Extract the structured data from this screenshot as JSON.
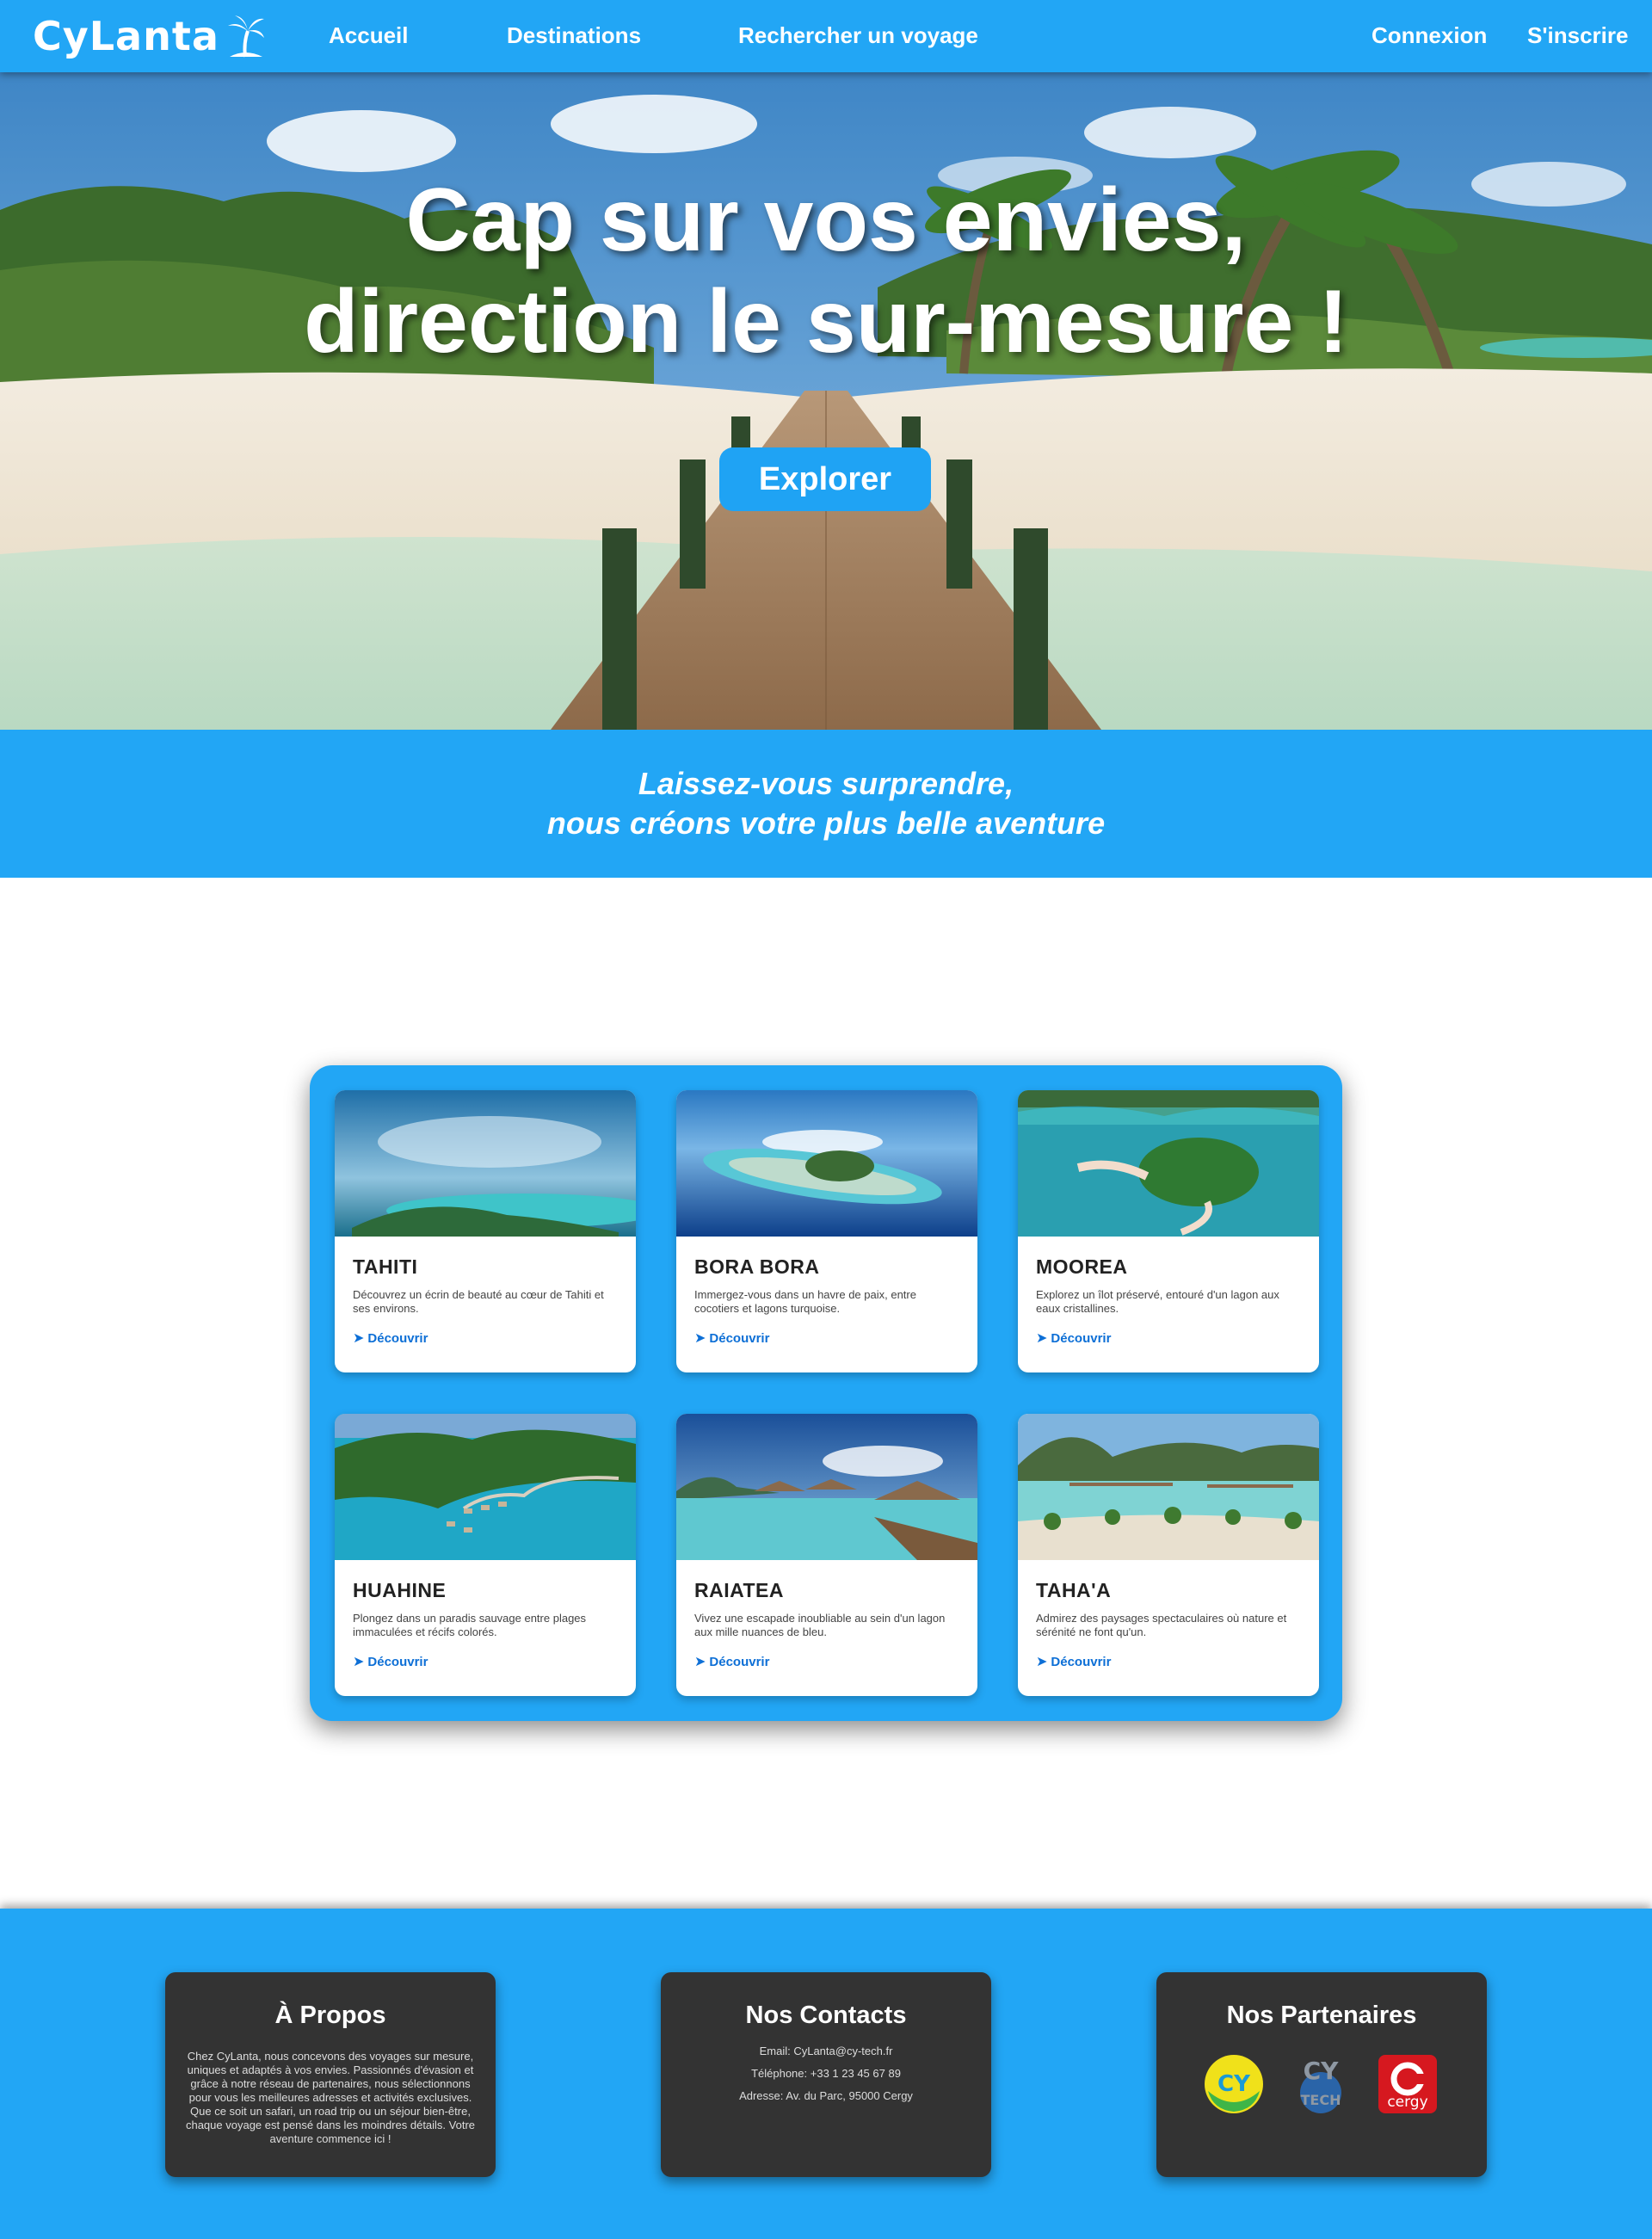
{
  "nav": {
    "brand": "CyLanta",
    "links": [
      "Accueil",
      "Destinations",
      "Rechercher un voyage"
    ],
    "login": "Connexion",
    "signup": "S'inscrire",
    "brand_color": "#22a6f5"
  },
  "hero": {
    "title_line1": "Cap sur vos envies,",
    "title_line2": "direction le sur-mesure !",
    "cta": "Explorer"
  },
  "tagline": {
    "line1": "Laissez-vous surprendre,",
    "line2": "nous créons votre plus belle aventure"
  },
  "destinations": [
    {
      "name": "TAHITI",
      "description": "Découvrez un écrin de beauté au cœur de Tahiti et ses environs.",
      "link": "Découvrir"
    },
    {
      "name": "BORA BORA",
      "description": "Immergez-vous dans un havre de paix, entre cocotiers et lagons turquoise.",
      "link": "Découvrir"
    },
    {
      "name": "MOOREA",
      "description": "Explorez un îlot préservé, entouré d'un lagon aux eaux cristallines.",
      "link": "Découvrir"
    },
    {
      "name": "HUAHINE",
      "description": "Plongez dans un paradis sauvage entre plages immaculées et récifs colorés.",
      "link": "Découvrir"
    },
    {
      "name": "RAIATEA",
      "description": "Vivez une escapade inoubliable au sein d'un lagon aux mille nuances de bleu.",
      "link": "Découvrir"
    },
    {
      "name": "TAHA'A",
      "description": "Admirez des paysages spectaculaires où nature et sérénité ne font qu'un.",
      "link": "Découvrir"
    }
  ],
  "footer": {
    "about": {
      "title": "À Propos",
      "text": "Chez CyLanta, nous concevons des voyages sur mesure, uniques et adaptés à vos envies. Passionnés d'évasion et grâce à notre réseau de partenaires, nous sélectionnons pour vous les meilleures adresses et activités exclusives. Que ce soit un safari, un road trip ou un séjour bien-être, chaque voyage est pensé dans les moindres détails. Votre aventure commence ici !"
    },
    "contacts": {
      "title": "Nos Contacts",
      "email": "Email: CyLanta@cy-tech.fr",
      "phone": "Téléphone: +33 1 23 45 67 89",
      "address": "Adresse: Av. du Parc, 95000 Cergy"
    },
    "partners": {
      "title": "Nos Partenaires",
      "logos": [
        {
          "icon": "cy-logo",
          "text": "CY"
        },
        {
          "icon": "cy-tech-logo",
          "text": "TECH"
        },
        {
          "icon": "cergy-logo",
          "text": "cergy"
        }
      ]
    }
  }
}
